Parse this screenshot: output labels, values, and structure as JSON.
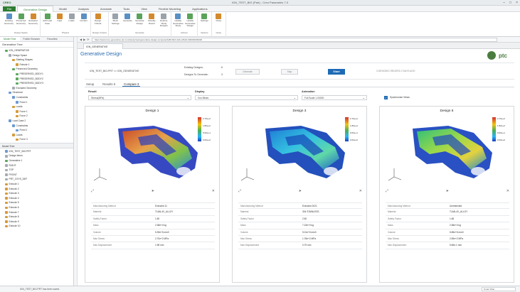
{
  "window": {
    "brand": "CREO",
    "title": "IGN_TEST_BIG (Part) - Creo Parametric 7.0"
  },
  "menu": {
    "file": "File",
    "tabs": [
      "Generative Design",
      "Model",
      "Analysis",
      "Annotate",
      "Tools",
      "View",
      "Flexible Modeling",
      "Applications"
    ]
  },
  "ribbon": {
    "groups": [
      {
        "name": "Design Space",
        "buttons": [
          "Existing Geometry",
          "Preserved Geometry",
          "Excluded Geometry"
        ]
      },
      {
        "name": "Physics",
        "buttons": [
          "Add Load Case",
          "Load",
          "Loads",
          "Contact"
        ]
      },
      {
        "name": "Design Criteria",
        "buttons": [
          "Design Criteria"
        ]
      },
      {
        "name": "Generate",
        "buttons": [
          "Mesh Settings",
          "Generate",
          "Generate Design",
          "Simplify Result",
          "Explore Study Designs"
        ]
      },
      {
        "name": "Actions",
        "buttons": [
          "Update Generative Study",
          "Update Generative Design"
        ]
      },
      {
        "name": "Options",
        "buttons": [
          "Settings"
        ]
      },
      {
        "name": "Close",
        "buttons": [
          "Close"
        ]
      }
    ]
  },
  "left_panel": {
    "tabs": [
      "Model Tree",
      "Folder Browser",
      "Favorites"
    ],
    "tree_title": "Generative Tree",
    "tree": [
      {
        "label": "IGN_GENERATIVE",
        "indent": 1,
        "icon": "g"
      },
      {
        "label": "Design Space",
        "indent": 2,
        "icon": "gr"
      },
      {
        "label": "Starting Shapes",
        "indent": 3,
        "icon": "o"
      },
      {
        "label": "Extrude 1",
        "indent": 4,
        "icon": "o"
      },
      {
        "label": "Preserved Geometry",
        "indent": 3,
        "icon": "g"
      },
      {
        "label": "PRESERVED_BODY1",
        "indent": 4,
        "icon": "g"
      },
      {
        "label": "PRESERVED_BODY2",
        "indent": 4,
        "icon": "g"
      },
      {
        "label": "PRESERVED_BODY3",
        "indent": 4,
        "icon": "g"
      },
      {
        "label": "Excluded Geometry",
        "indent": 3,
        "icon": "gr"
      },
      {
        "label": "Structural",
        "indent": 2,
        "icon": "b"
      },
      {
        "label": "Constraints",
        "indent": 3,
        "icon": "b"
      },
      {
        "label": "Fixed 1",
        "indent": 4,
        "icon": "b"
      },
      {
        "label": "Loads",
        "indent": 3,
        "icon": "o"
      },
      {
        "label": "Force 1",
        "indent": 4,
        "icon": "o"
      },
      {
        "label": "Force 2",
        "indent": 4,
        "icon": "o"
      },
      {
        "label": "Load Case 2",
        "indent": 2,
        "icon": "b"
      },
      {
        "label": "Constraints",
        "indent": 3,
        "icon": "b"
      },
      {
        "label": "Fixed 1",
        "indent": 4,
        "icon": "b"
      },
      {
        "label": "Loads",
        "indent": 3,
        "icon": "o"
      },
      {
        "label": "Force 3",
        "indent": 4,
        "icon": "o"
      }
    ],
    "model_tree_title": "Model Tree",
    "model_tree": [
      {
        "label": "IGN_TEST_BIG.PRT",
        "indent": 1,
        "icon": "b"
      },
      {
        "label": "Design Items",
        "indent": 1,
        "icon": "gr"
      },
      {
        "label": "Generative 1",
        "indent": 1,
        "icon": "g"
      },
      {
        "label": "RIGHT",
        "indent": 1,
        "icon": "gr"
      },
      {
        "label": "TOP",
        "indent": 1,
        "icon": "gr"
      },
      {
        "label": "FRONT",
        "indent": 1,
        "icon": "gr"
      },
      {
        "label": "PRT_CSYS_DEF",
        "indent": 1,
        "icon": "gr"
      },
      {
        "label": "Extrude 1",
        "indent": 1,
        "icon": "o"
      },
      {
        "label": "Extrude 2",
        "indent": 1,
        "icon": "o"
      },
      {
        "label": "Extrude 3",
        "indent": 1,
        "icon": "o"
      },
      {
        "label": "Extrude 4",
        "indent": 1,
        "icon": "o"
      },
      {
        "label": "Extrude 5",
        "indent": 1,
        "icon": "o"
      },
      {
        "label": "Extrude 6",
        "indent": 1,
        "icon": "o"
      },
      {
        "label": "Extrude 7",
        "indent": 1,
        "icon": "o"
      },
      {
        "label": "Extrude 8",
        "indent": 1,
        "icon": "o"
      },
      {
        "label": "Extrude 9",
        "indent": 1,
        "icon": "o"
      },
      {
        "label": "Extrude 10",
        "indent": 1,
        "icon": "o"
      }
    ]
  },
  "browser": {
    "url": "https://www.creo-generative.ptc.com/study/view/generative-design-compare/2a8f-99c3-4d1e-8b22-000000000000",
    "tab": "IGN_GENERATIVE"
  },
  "page": {
    "title": "Generative Design",
    "logo_text": "ptc",
    "study_name": "IGN_TEST_BIG.PRT >> IGN_GENERATIVE",
    "existing_designs_label": "Existing Designs:",
    "existing_designs_value": "6",
    "designs_to_generate_label": "Designs To Generate:",
    "designs_to_generate_value": "3",
    "generate_button": "Generate",
    "stop_button": "Stop",
    "share_button": "Share",
    "status_text": "3 DESIGNS CREATED 2 DAYS AGO",
    "subtabs": [
      "Setup",
      "Results 6",
      "Compare 3"
    ],
    "result_label": "Result",
    "result_value": "Stress(MPa)",
    "display_label": "Display",
    "display_value": "Von Mises",
    "animation_label": "Animation",
    "animation_value": "Full Scale 1.00000",
    "sync_label": "Synchronize Views"
  },
  "cards": [
    {
      "title": "Design 1",
      "props": [
        [
          "Manufacturing Method",
          "Extruded 11"
        ],
        [
          "Material",
          "Ti-6Al-4V_ALLOY"
        ],
        [
          "Safety Factor",
          "1.50"
        ],
        [
          "Mass",
          "2.38e+0 kg"
        ],
        [
          "Volume",
          "5.39e+5 mm3"
        ],
        [
          "Max Stress",
          "2.70e+2 MPa"
        ],
        [
          "Max Displacement",
          "1.98 mm"
        ]
      ]
    },
    {
      "title": "Design 3",
      "props": [
        [
          "Manufacturing Method",
          "Extruded 2021"
        ],
        [
          "Material",
          "304 STAINLESS"
        ],
        [
          "Safety Factor",
          "2.50"
        ],
        [
          "Mass",
          "7.23e+0 kg"
        ],
        [
          "Volume",
          "9.01e+5 mm3"
        ],
        [
          "Max Stress",
          "1.78e+2 MPa"
        ],
        [
          "Max Displacement",
          "0.79 mm"
        ]
      ]
    },
    {
      "title": "Design 6",
      "props": [
        [
          "Manufacturing Method",
          "Unrestricted"
        ],
        [
          "Material",
          "Ti-6Al-4V_ALLOY"
        ],
        [
          "Safety Factor",
          "1.65"
        ],
        [
          "Mass",
          "2.58e+0 kg"
        ],
        [
          "Volume",
          "5.85e+5 mm3"
        ],
        [
          "Max Stress",
          "2.59e+2 MPa"
        ],
        [
          "Max Displacement",
          "5.65e-1 mm"
        ]
      ]
    }
  ],
  "legend_labels": [
    "2.70e+2",
    "1.80e+2",
    "9.00e+1",
    "0.00e+0"
  ],
  "statusbar": {
    "text": "IGN_TEST_BIG.PRT has been saved.",
    "selector": "Smart Filter"
  },
  "colors": {
    "accent": "#2e7d32",
    "primary": "#1e6ab5",
    "title": "#2b6cb0"
  }
}
